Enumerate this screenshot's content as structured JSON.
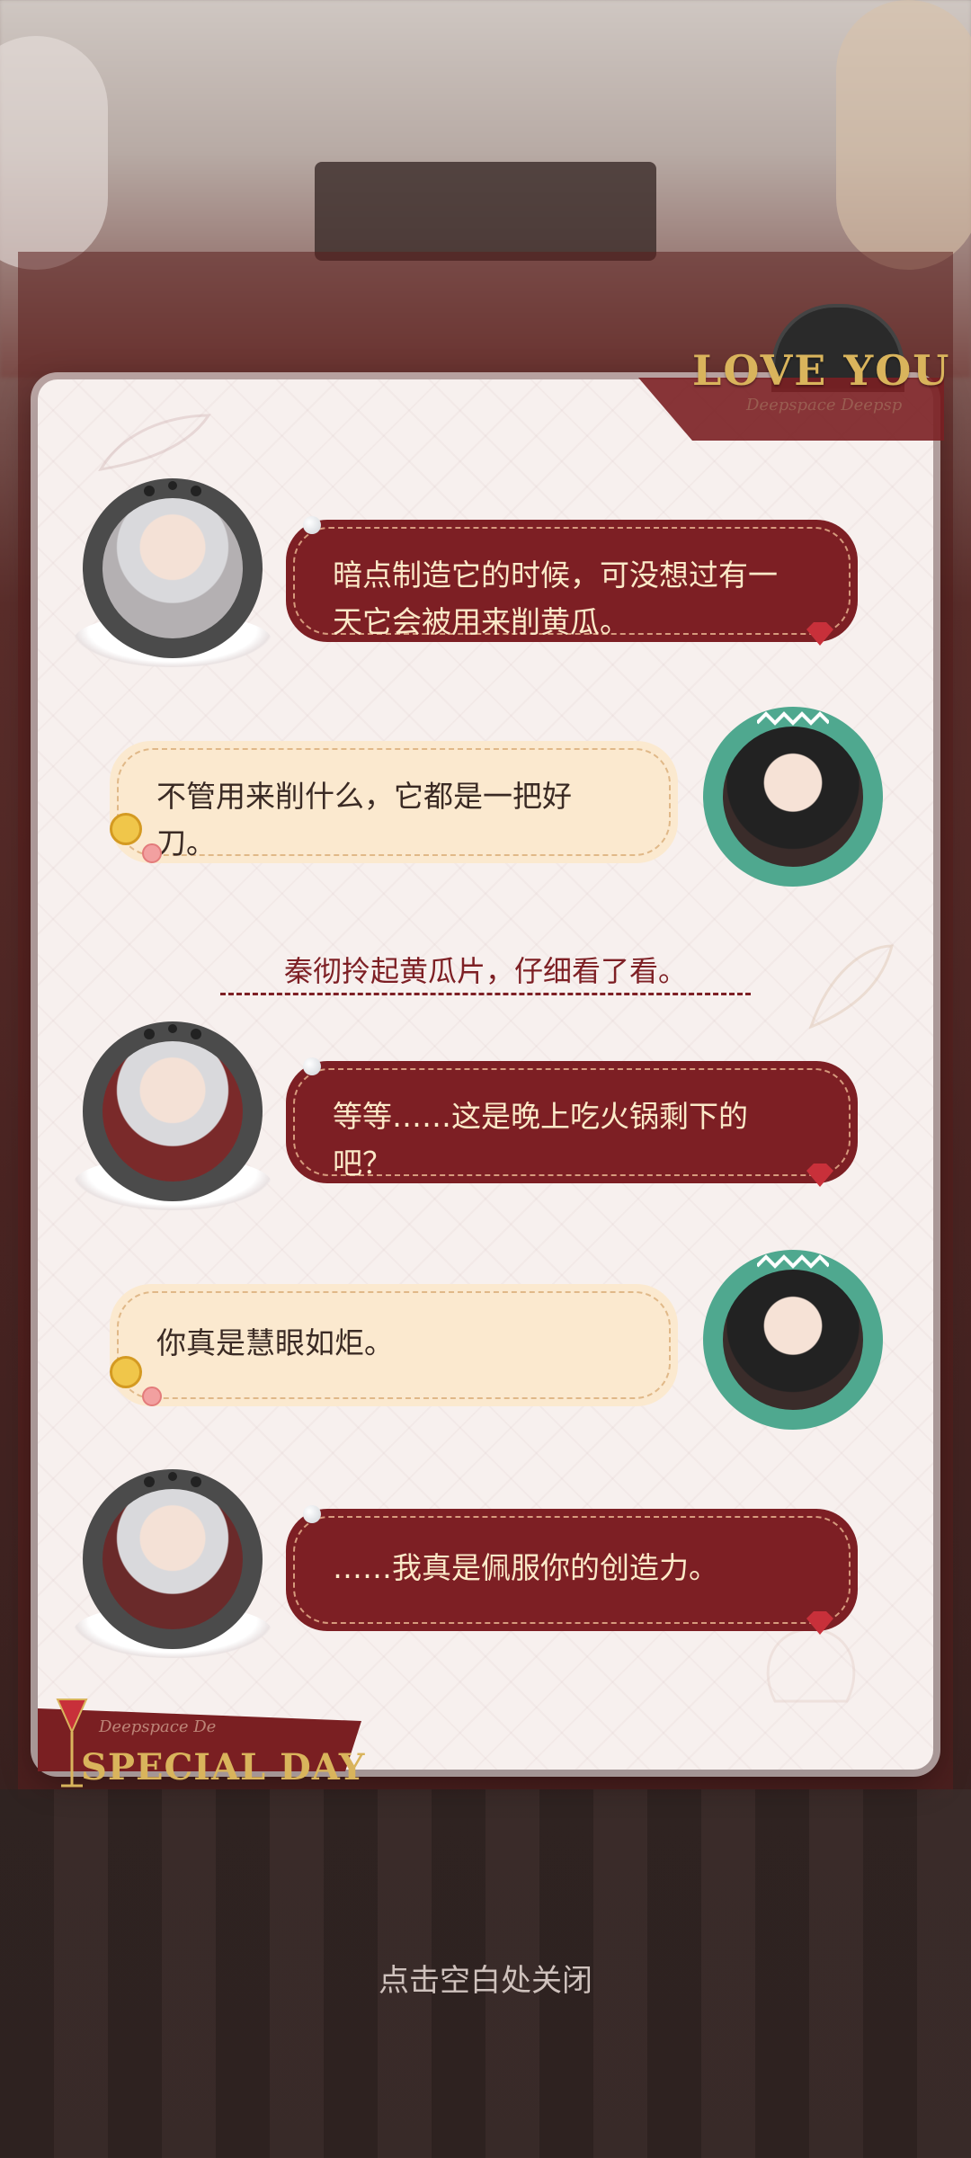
{
  "decor": {
    "love_you": "LOVE YOU",
    "special_day": "SPECIAL DAY",
    "subtext_top": "Deepspace Deepsp",
    "subtext_bottom": "Deepspace De"
  },
  "dialogue": [
    {
      "speaker": "male",
      "text_line1": "暗点制造它的时候，可没想过有一",
      "text_line2": "天它会被用来削黄瓜。"
    },
    {
      "speaker": "female",
      "text_line1": "不管用来削什么，它都是一把好",
      "text_line2": "刀。"
    },
    {
      "speaker": "male",
      "text_line1": "等等……这是晚上吃火锅剩下的",
      "text_line2": "吧？"
    },
    {
      "speaker": "female",
      "text_line1": "你真是慧眼如炬。",
      "text_line2": ""
    },
    {
      "speaker": "male",
      "text_line1": "……我真是佩服你的创造力。",
      "text_line2": ""
    }
  ],
  "narration": "秦彻拎起黄瓜片，仔细看了看。",
  "close_hint": "点击空白处关闭",
  "colors": {
    "male_bubble": "#7d1f24",
    "female_bubble": "#fbe9cf",
    "accent_gold": "#d9b45c",
    "male_ring": "#4b4b4b",
    "female_ring": "#4fa88f"
  }
}
